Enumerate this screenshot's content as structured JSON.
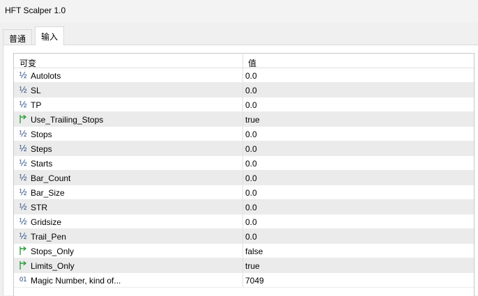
{
  "window": {
    "title": "HFT Scalper 1.0"
  },
  "tabs": [
    {
      "label": "普通",
      "active": false
    },
    {
      "label": "输入",
      "active": true
    }
  ],
  "table": {
    "columns": {
      "variable": "可变",
      "value": "值"
    },
    "rows": [
      {
        "icon": "fraction-icon",
        "icon_text": "½",
        "name": "Autolots",
        "value": "0.0"
      },
      {
        "icon": "fraction-icon",
        "icon_text": "½",
        "name": "SL",
        "value": "0.0"
      },
      {
        "icon": "fraction-icon",
        "icon_text": "½",
        "name": "TP",
        "value": "0.0"
      },
      {
        "icon": "bool-arrow-icon",
        "icon_text": "",
        "name": "Use_Trailing_Stops",
        "value": "true"
      },
      {
        "icon": "fraction-icon",
        "icon_text": "½",
        "name": "Stops",
        "value": "0.0"
      },
      {
        "icon": "fraction-icon",
        "icon_text": "½",
        "name": "Steps",
        "value": "0.0"
      },
      {
        "icon": "fraction-icon",
        "icon_text": "½",
        "name": "Starts",
        "value": "0.0"
      },
      {
        "icon": "fraction-icon",
        "icon_text": "½",
        "name": "Bar_Count",
        "value": "0.0"
      },
      {
        "icon": "fraction-icon",
        "icon_text": "½",
        "name": "Bar_Size",
        "value": "0.0"
      },
      {
        "icon": "fraction-icon",
        "icon_text": "½",
        "name": "STR",
        "value": "0.0"
      },
      {
        "icon": "fraction-icon",
        "icon_text": "½",
        "name": "Gridsize",
        "value": "0.0"
      },
      {
        "icon": "fraction-icon",
        "icon_text": "½",
        "name": "Trail_Pen",
        "value": "0.0"
      },
      {
        "icon": "bool-arrow-icon",
        "icon_text": "",
        "name": "Stops_Only",
        "value": "false"
      },
      {
        "icon": "bool-arrow-icon",
        "icon_text": "",
        "name": "Limits_Only",
        "value": "true"
      },
      {
        "icon": "integer-icon",
        "icon_text": "01",
        "name": "Magic Number, kind of...",
        "value": "7049"
      }
    ]
  },
  "colors": {
    "bool_icon": "#2e9e3e",
    "numeric_icon": "#2e4f87",
    "row_alt_bg": "#ebebeb"
  }
}
